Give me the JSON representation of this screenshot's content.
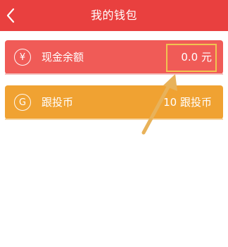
{
  "header": {
    "title": "我的钱包"
  },
  "wallet": {
    "cash": {
      "icon_symbol": "¥",
      "label": "现金余额",
      "value": "0.0 元"
    },
    "coin": {
      "icon_symbol": "G",
      "label": "跟投币",
      "value": "10 跟投币"
    }
  },
  "colors": {
    "header_bg": "#e9403f",
    "cash_card": "#f05b57",
    "coin_card": "#f0a232",
    "annotation": "#f0c451"
  },
  "icons": {
    "back": "chevron-left-icon",
    "cash": "yen-circle-icon",
    "coin": "coin-circle-icon",
    "annotation": "arrow-annotation-icon"
  }
}
